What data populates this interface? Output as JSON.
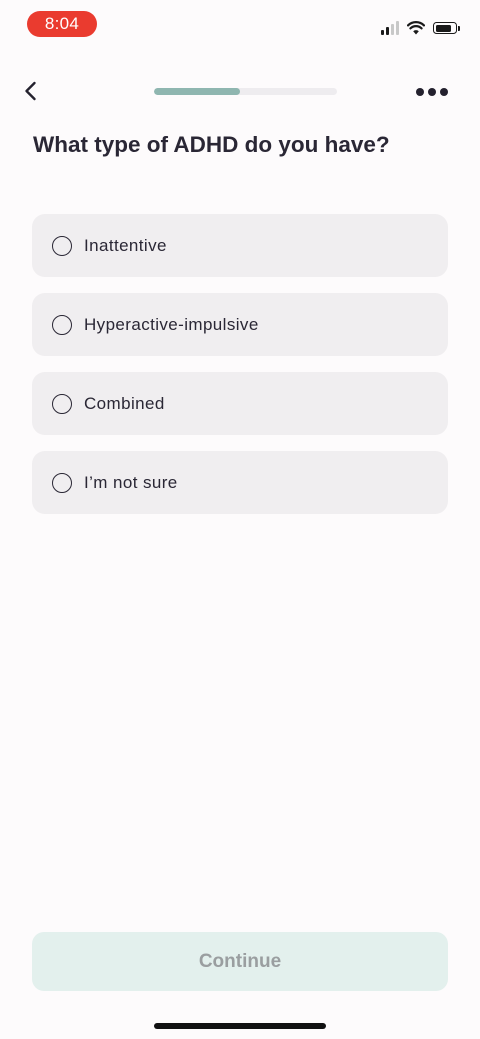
{
  "status_bar": {
    "time": "8:04",
    "time_pill_color": "#ea3b2f",
    "signal_bars_active": 2,
    "signal_bars_total": 4
  },
  "nav": {
    "back_icon": "chevron-left-icon",
    "more_icon": "ellipsis-icon",
    "progress_fraction": 0.47,
    "progress_color": "#8fb6b0"
  },
  "question": {
    "title": "What type of ADHD do you have?"
  },
  "options": [
    {
      "label": "Inattentive",
      "selected": false
    },
    {
      "label": "Hyperactive-impulsive",
      "selected": false
    },
    {
      "label": "Combined",
      "selected": false
    },
    {
      "label": "I’m not sure",
      "selected": false
    }
  ],
  "footer": {
    "continue_label": "Continue",
    "continue_enabled": false,
    "continue_bg": "#e3f0ed"
  }
}
